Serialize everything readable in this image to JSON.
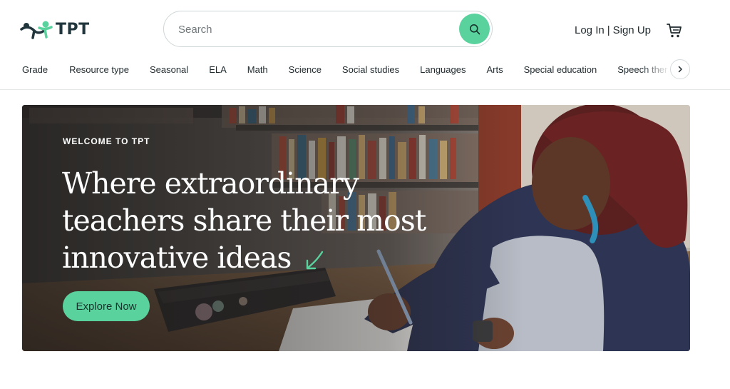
{
  "brand": {
    "name": "TPT",
    "accent": "#5ad29e",
    "dark": "#20363c"
  },
  "search": {
    "placeholder": "Search",
    "value": "",
    "icon": "search-icon"
  },
  "auth": {
    "login": "Log In",
    "separator": "|",
    "signup": "Sign Up"
  },
  "cart": {
    "icon": "cart-icon"
  },
  "nav": {
    "items": [
      {
        "label": "Grade"
      },
      {
        "label": "Resource type"
      },
      {
        "label": "Seasonal"
      },
      {
        "label": "ELA"
      },
      {
        "label": "Math"
      },
      {
        "label": "Science"
      },
      {
        "label": "Social studies"
      },
      {
        "label": "Languages"
      },
      {
        "label": "Arts"
      },
      {
        "label": "Special education"
      },
      {
        "label": "Speech therapy"
      }
    ],
    "next_icon": "chevron-right-icon"
  },
  "hero": {
    "eyebrow": "WELCOME TO TPT",
    "title": "Where extraordinary teachers share their most innovative ideas",
    "cta": "Explore Now"
  }
}
